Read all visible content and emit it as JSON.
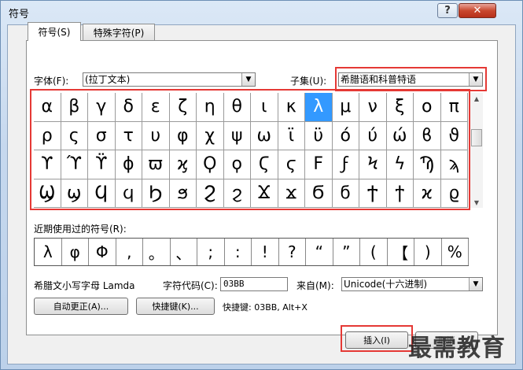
{
  "window": {
    "title": "符号",
    "help": "?",
    "close": "✕"
  },
  "tabs": [
    "符号(S)",
    "特殊字符(P)"
  ],
  "font": {
    "label": "字体(F):",
    "value": "(拉丁文本)"
  },
  "subset": {
    "label": "子集(U):",
    "value": "希腊语和科普特语"
  },
  "symbols": [
    "α",
    "β",
    "γ",
    "δ",
    "ε",
    "ζ",
    "η",
    "θ",
    "ι",
    "κ",
    "λ",
    "μ",
    "ν",
    "ξ",
    "ο",
    "π",
    "ρ",
    "ς",
    "σ",
    "τ",
    "υ",
    "φ",
    "χ",
    "ψ",
    "ω",
    "ϊ",
    "ϋ",
    "ό",
    "ύ",
    "ώ",
    "ϐ",
    "ϑ",
    "ϒ",
    "ϓ",
    "ϔ",
    "ϕ",
    "ϖ",
    "ϗ",
    "Ϙ",
    "ϙ",
    "Ϛ",
    "ϛ",
    "Ϝ",
    "ϝ",
    "Ϟ",
    "ϟ",
    "Ϡ",
    "ϡ",
    "Ϣ",
    "ϣ",
    "Ϥ",
    "ϥ",
    "Ϧ",
    "ϧ",
    "Ϩ",
    "ϩ",
    "Ϫ",
    "ϫ",
    "Ϭ",
    "ϭ",
    "Ϯ",
    "ϯ",
    "ϰ",
    "ϱ"
  ],
  "selected_index": 10,
  "recent_label": "近期使用过的符号(R):",
  "recent": [
    "λ",
    "φ",
    "Φ",
    ",",
    "。",
    "、",
    ";",
    ":",
    "!",
    "?",
    "“",
    "”",
    "(",
    "【",
    ")",
    "%"
  ],
  "description": "希腊文小写字母 Lamda",
  "charcode": {
    "label": "字符代码(C):",
    "value": "03BB"
  },
  "from": {
    "label": "来自(M):",
    "value": "Unicode(十六进制)"
  },
  "buttons": {
    "autocorrect": "自动更正(A)...",
    "shortcut": "快捷键(K)...",
    "insert": "插入(I)",
    "cancel": "取消"
  },
  "shortcut_text": "快捷键: 03BB, Alt+X",
  "watermark": "最需教育"
}
